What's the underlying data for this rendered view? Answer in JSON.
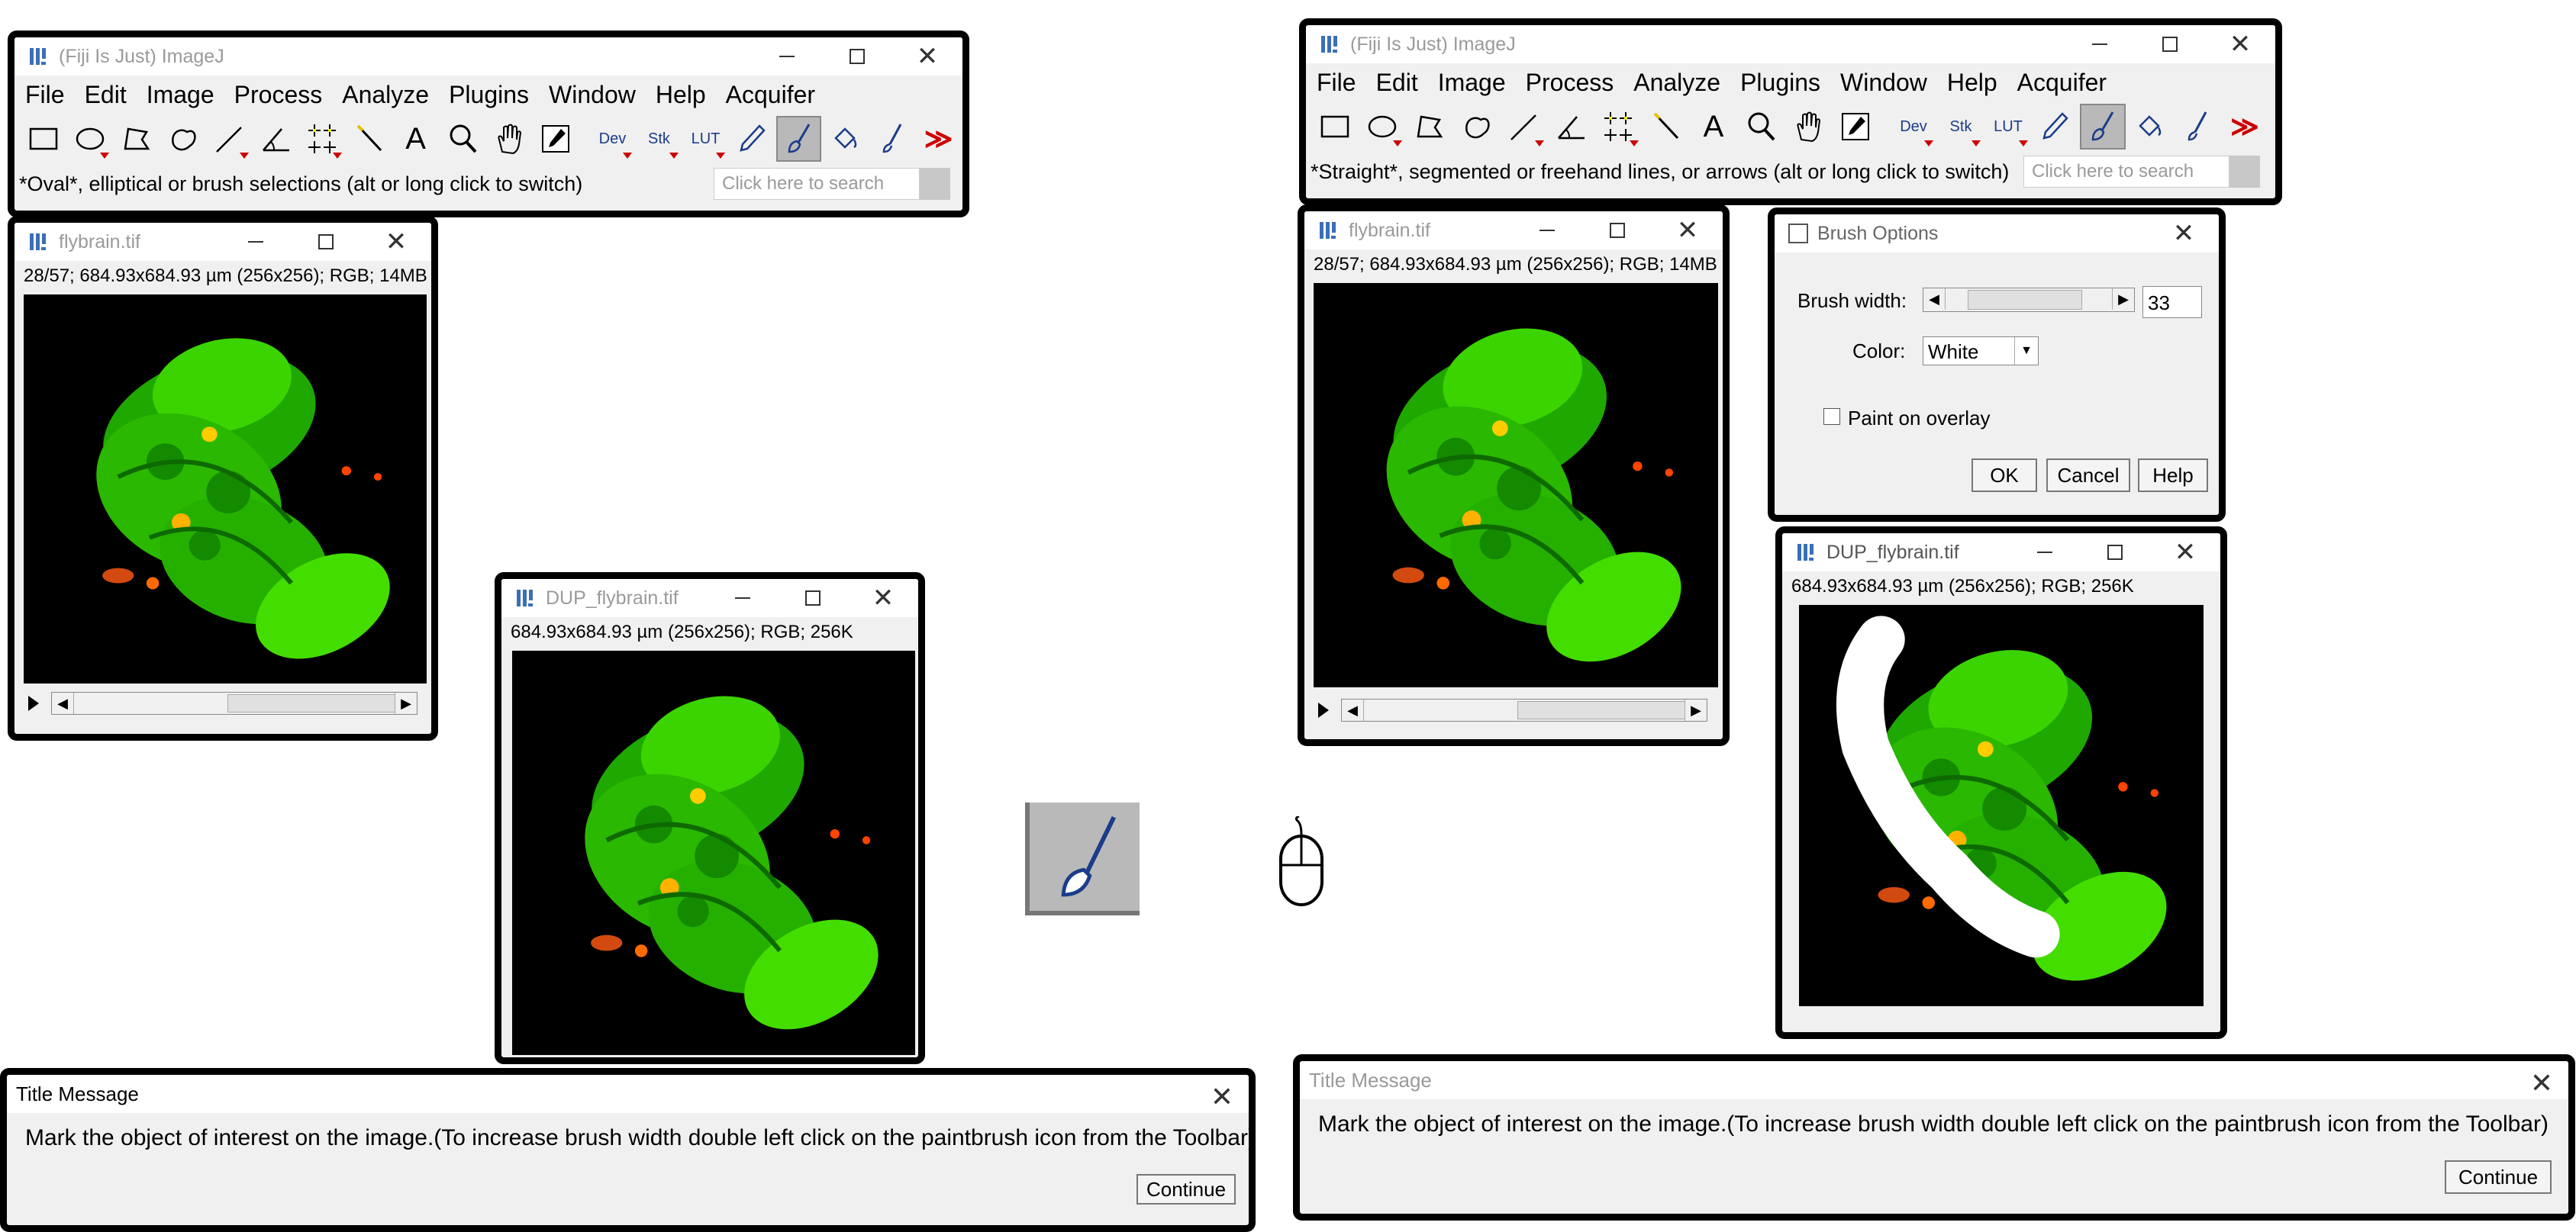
{
  "left": {
    "imagej": {
      "title": "(Fiji Is Just) ImageJ",
      "menus": [
        "File",
        "Edit",
        "Image",
        "Process",
        "Analyze",
        "Plugins",
        "Window",
        "Help",
        "Acquifer"
      ],
      "status": "*Oval*, elliptical or brush selections (alt or long click to switch)",
      "search_placeholder": "Click here to search",
      "tools": [
        "rectangle-tool",
        "oval-tool",
        "polygon-tool",
        "freehand-tool",
        "line-tool",
        "angle-tool",
        "multipoint-tool",
        "wand-tool",
        "text-tool",
        "magnifier-tool",
        "hand-tool",
        "dropper-tool",
        "dev-tool",
        "stk-tool",
        "lut-tool",
        "pencil-tool",
        "paintbrush-tool",
        "flood-fill-tool",
        "brush-tool",
        "more-tools"
      ],
      "tool_labels": {
        "dev": "Dev",
        "stk": "Stk",
        "lut": "LUT",
        "text": "A",
        "more": "≫"
      }
    },
    "flybrain": {
      "title": "flybrain.tif",
      "info": "28/57; 684.93x684.93 µm (256x256); RGB; 14MB"
    },
    "dup": {
      "title": "DUP_flybrain.tif",
      "info": "684.93x684.93 µm (256x256); RGB; 256K"
    },
    "message": {
      "title": "Title Message",
      "text": "Mark the object of interest on the image.(To increase brush width double left click on the paintbrush icon from the Toolbar)",
      "button": "Continue"
    }
  },
  "right": {
    "imagej": {
      "title": "(Fiji Is Just) ImageJ",
      "menus": [
        "File",
        "Edit",
        "Image",
        "Process",
        "Analyze",
        "Plugins",
        "Window",
        "Help",
        "Acquifer"
      ],
      "status": "*Straight*, segmented or freehand lines, or arrows (alt or long click to switch)",
      "search_placeholder": "Click here to search"
    },
    "flybrain": {
      "title": "flybrain.tif",
      "info": "28/57; 684.93x684.93 µm (256x256); RGB; 14MB"
    },
    "brush_options": {
      "title": "Brush Options",
      "width_label": "Brush width:",
      "width_value": "33",
      "width_fraction": 0.7,
      "color_label": "Color:",
      "color_value": "White",
      "overlay_label": "Paint on overlay",
      "overlay_checked": false,
      "ok": "OK",
      "cancel": "Cancel",
      "help": "Help"
    },
    "dup": {
      "title": "DUP_flybrain.tif",
      "info": "684.93x684.93 µm (256x256); RGB; 256K"
    },
    "message": {
      "title": "Title Message",
      "text": "Mark the object of interest on the image.(To increase brush width double left click on the paintbrush icon from the Toolbar)",
      "button": "Continue"
    }
  },
  "colors": {
    "tissue": "#2fd400",
    "tissue_dark": "#1a8f00",
    "signal": "#ff5a1f",
    "stroke": "#ffffff",
    "selected_tool": "#b9b9b9"
  }
}
